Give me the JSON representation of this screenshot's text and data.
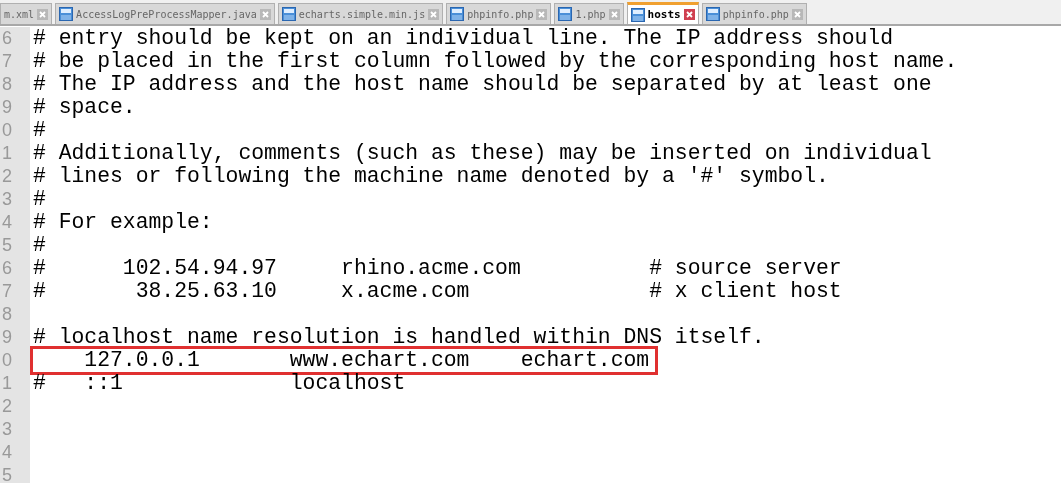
{
  "tabs": [
    {
      "label": "m.xml",
      "selected": false,
      "icon": false
    },
    {
      "label": "AccessLogPreProcessMapper.java",
      "selected": false,
      "icon": true
    },
    {
      "label": "echarts.simple.min.js",
      "selected": false,
      "icon": true
    },
    {
      "label": "phpinfo.php",
      "selected": false,
      "icon": true
    },
    {
      "label": "1.php",
      "selected": false,
      "icon": true
    },
    {
      "label": "hosts",
      "selected": true,
      "icon": true
    },
    {
      "label": "phpinfo.php",
      "selected": false,
      "icon": true
    }
  ],
  "lines": [
    {
      "number": "6",
      "text": "# entry should be kept on an individual line. The IP address should",
      "highlighted": false
    },
    {
      "number": "7",
      "text": "# be placed in the first column followed by the corresponding host name.",
      "highlighted": false
    },
    {
      "number": "8",
      "text": "# The IP address and the host name should be separated by at least one",
      "highlighted": false
    },
    {
      "number": "9",
      "text": "# space.",
      "highlighted": false
    },
    {
      "number": "0",
      "text": "#",
      "highlighted": false
    },
    {
      "number": "1",
      "text": "# Additionally, comments (such as these) may be inserted on individual",
      "highlighted": false
    },
    {
      "number": "2",
      "text": "# lines or following the machine name denoted by a '#' symbol.",
      "highlighted": false
    },
    {
      "number": "3",
      "text": "#",
      "highlighted": false
    },
    {
      "number": "4",
      "text": "# For example:",
      "highlighted": false
    },
    {
      "number": "5",
      "text": "#",
      "highlighted": false
    },
    {
      "number": "6",
      "text": "#      102.54.94.97     rhino.acme.com          # source server",
      "highlighted": false
    },
    {
      "number": "7",
      "text": "#       38.25.63.10     x.acme.com              # x client host",
      "highlighted": false
    },
    {
      "number": "8",
      "highlighted": false
    },
    {
      "number": "9",
      "text": "# localhost name resolution is handled within DNS itself.",
      "highlighted": false
    },
    {
      "number": "0",
      "text": "    127.0.0.1       www.echart.com    echart.com",
      "highlighted": true
    },
    {
      "number": "1",
      "text": "#   ::1             localhost",
      "highlighted": false
    },
    {
      "number": "2",
      "highlighted": false
    },
    {
      "number": "3",
      "highlighted": false
    },
    {
      "number": "4",
      "highlighted": false
    },
    {
      "number": "5",
      "highlighted": false
    }
  ]
}
